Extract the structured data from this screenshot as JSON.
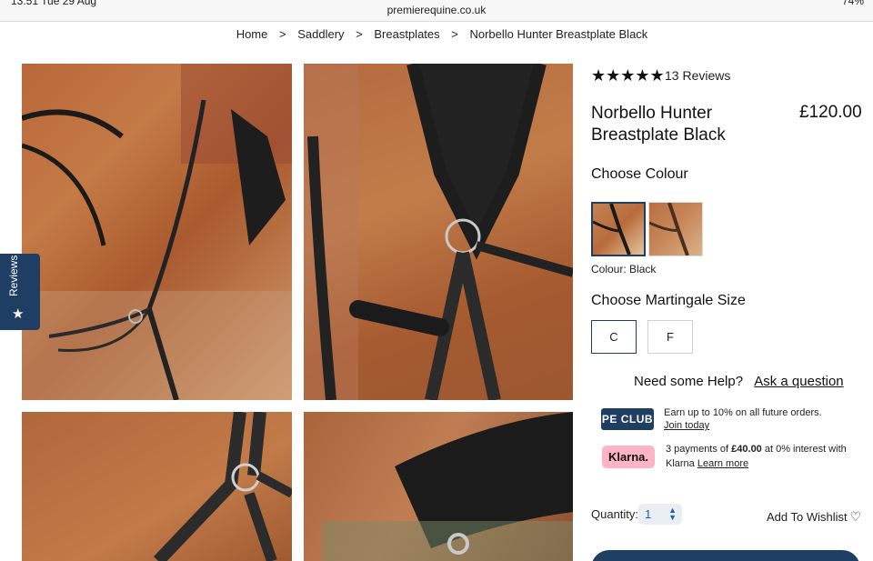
{
  "browser": {
    "status_left": "13:51  Tue 29 Aug",
    "url": "premierequine.co.uk",
    "status_right": "74%"
  },
  "breadcrumb": {
    "items": [
      "Home",
      "Saddlery",
      "Breastplates",
      "Norbello Hunter Breastplate Black"
    ],
    "separator": ">"
  },
  "reviews_tab": {
    "label": "Reviews",
    "icon": "star-icon"
  },
  "product": {
    "stars": "★★★★★",
    "rating": 5,
    "reviews_count": "13 Reviews",
    "title": "Norbello Hunter Breastplate Black",
    "price": "£120.00",
    "choose_colour_label": "Choose Colour",
    "selected_colour": "Colour: Black",
    "choose_size_label": "Choose Martingale Size",
    "sizes": [
      "C",
      "F"
    ],
    "selected_size": "C"
  },
  "help": {
    "text": "Need some Help?",
    "link": "Ask a question"
  },
  "peclub": {
    "logo": "PE CLUB",
    "text": "Earn up to 10% on all future orders.",
    "link": "Join today"
  },
  "klarna": {
    "logo": "Klarna.",
    "text_prefix": "3 payments of ",
    "amount": "£40.00",
    "text_suffix": " at 0% interest with Klarna",
    "link": "Learn more"
  },
  "quantity": {
    "label": "Quantity:",
    "value": "1"
  },
  "wishlist": {
    "label": "Add To Wishlist",
    "icon": "heart-icon"
  },
  "colors": {
    "navy": "#1f3e63",
    "klarna_pink": "#ffb3c7"
  }
}
